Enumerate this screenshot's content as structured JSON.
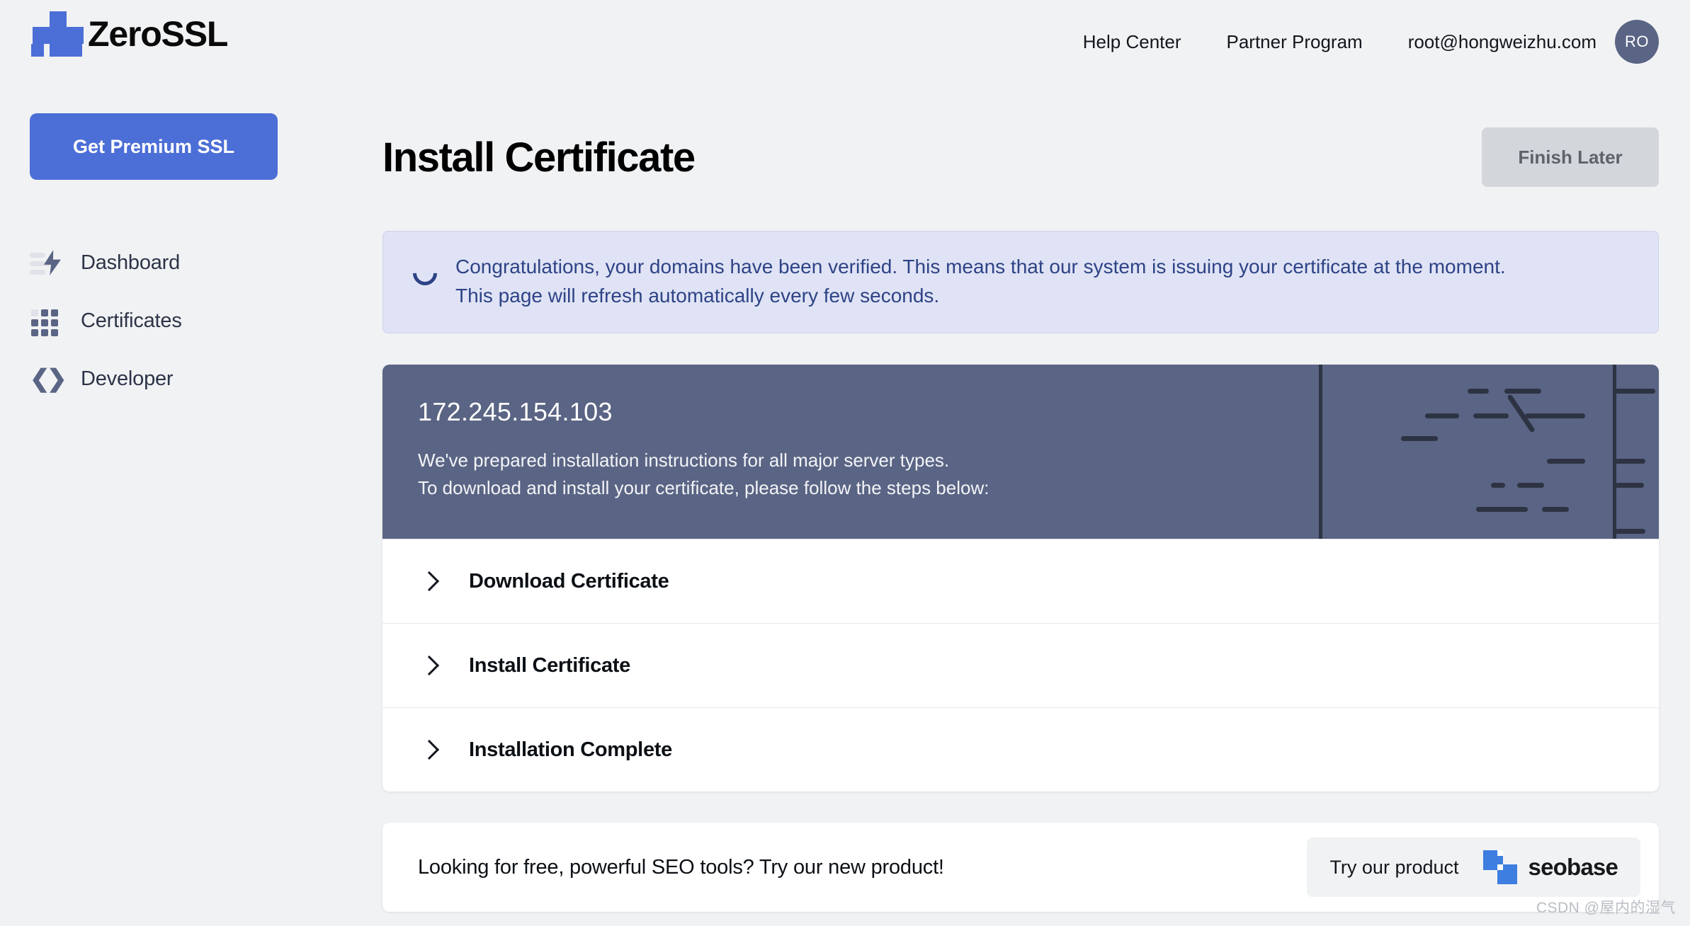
{
  "header": {
    "brand_name": "ZeroSSL",
    "brand_logo_icon": "zerossl-cross-logo",
    "nav": [
      {
        "label": "Help Center",
        "name": "nav-help-center"
      },
      {
        "label": "Partner Program",
        "name": "nav-partner-program"
      },
      {
        "label": "root@hongweizhu.com",
        "name": "nav-account-email"
      }
    ],
    "avatar_initials": "RO",
    "avatar_color": "#5a6484"
  },
  "sidebar": {
    "premium_button": "Get Premium SSL",
    "premium_button_color": "#4c6ed7",
    "items": [
      {
        "label": "Dashboard",
        "icon": "dashboard-bolt-icon"
      },
      {
        "label": "Certificates",
        "icon": "grid-dots-icon"
      },
      {
        "label": "Developer",
        "icon": "code-brackets-icon"
      }
    ]
  },
  "main": {
    "page_title": "Install Certificate",
    "finish_later_label": "Finish Later",
    "banner": {
      "icon": "spinner-icon",
      "line1": "Congratulations, your domains have been verified. This means that our system is issuing your certificate at the moment.",
      "line2": "This page will refresh automatically every few seconds.",
      "text_color": "#2e4386",
      "background_color": "#dfe3f5"
    },
    "install_card": {
      "hero": {
        "ip_address": "172.245.154.103",
        "desc_line1": "We've prepared installation instructions for all major server types.",
        "desc_line2": "To download and install your certificate, please follow the steps below:",
        "background_color": "#5a6484"
      },
      "steps": [
        {
          "label": "Download Certificate",
          "icon": "chevron-right-icon"
        },
        {
          "label": "Install Certificate",
          "icon": "chevron-right-icon"
        },
        {
          "label": "Installation Complete",
          "icon": "chevron-right-icon"
        }
      ]
    },
    "promo": {
      "text": "Looking for free, powerful SEO tools? Try our new product!",
      "button_label": "Try our product",
      "product_name": "seobase",
      "product_logo_icon": "seobase-squares-logo",
      "product_logo_color": "#3d7ee0"
    }
  },
  "watermark": "CSDN @屋内的湿气"
}
